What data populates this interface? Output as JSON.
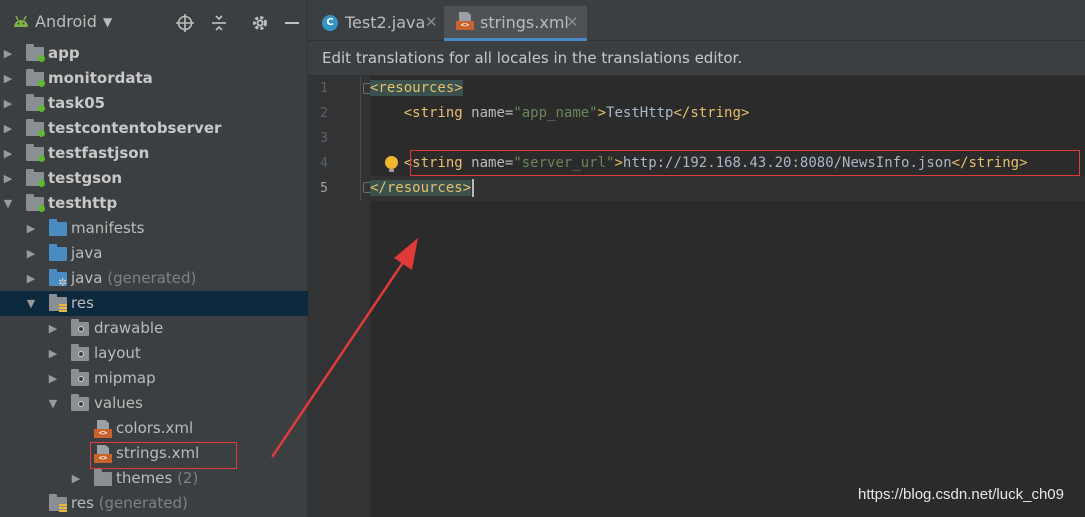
{
  "project_panel": {
    "view_name": "Android",
    "tree": [
      {
        "label": "app",
        "bold": true,
        "expanded": false
      },
      {
        "label": "monitordata",
        "bold": true,
        "expanded": false
      },
      {
        "label": "task05",
        "bold": true,
        "expanded": false
      },
      {
        "label": "testcontentobserver",
        "bold": true,
        "expanded": false
      },
      {
        "label": "testfastjson",
        "bold": true,
        "expanded": false
      },
      {
        "label": "testgson",
        "bold": true,
        "expanded": false
      },
      {
        "label": "testhttp",
        "bold": true,
        "expanded": true
      },
      {
        "label": "manifests"
      },
      {
        "label": "java"
      },
      {
        "label": "java",
        "suffix": "(generated)"
      },
      {
        "label": "res",
        "expanded": true,
        "selected": true
      },
      {
        "label": "drawable"
      },
      {
        "label": "layout"
      },
      {
        "label": "mipmap"
      },
      {
        "label": "values",
        "expanded": true
      },
      {
        "label": "colors.xml"
      },
      {
        "label": "strings.xml",
        "highlighted": true
      },
      {
        "label": "themes",
        "suffix": "(2)"
      },
      {
        "label": "res",
        "suffix": "(generated)"
      }
    ]
  },
  "editor": {
    "tabs": [
      {
        "label": "Test2.java",
        "active": false
      },
      {
        "label": "strings.xml",
        "active": true
      }
    ],
    "banner": "Edit translations for all locales in the translations editor.",
    "line_numbers": [
      "1",
      "2",
      "3",
      "4",
      "5"
    ],
    "code": {
      "l1_tag": "<resources>",
      "l2_indent": "    ",
      "l2_open": "<string ",
      "l2_attr": "name=",
      "l2_val": "\"app_name\"",
      "l2_close": ">",
      "l2_text": "TestHttp",
      "l2_end": "</string>",
      "l4_indent": "    ",
      "l4_open": "<string ",
      "l4_attr": "name=",
      "l4_val": "\"server_url\"",
      "l4_close": ">",
      "l4_text": "http://192.168.43.20:8080/NewsInfo.json",
      "l4_end": "</string>",
      "l5_tag": "</resources>"
    }
  },
  "watermark": "https://blog.csdn.net/luck_ch09",
  "colors": {
    "annotation_red": "#e03a3a",
    "xml_tag": "#e8bf6a",
    "xml_value": "#6a8759",
    "selection": "#0d293e"
  }
}
